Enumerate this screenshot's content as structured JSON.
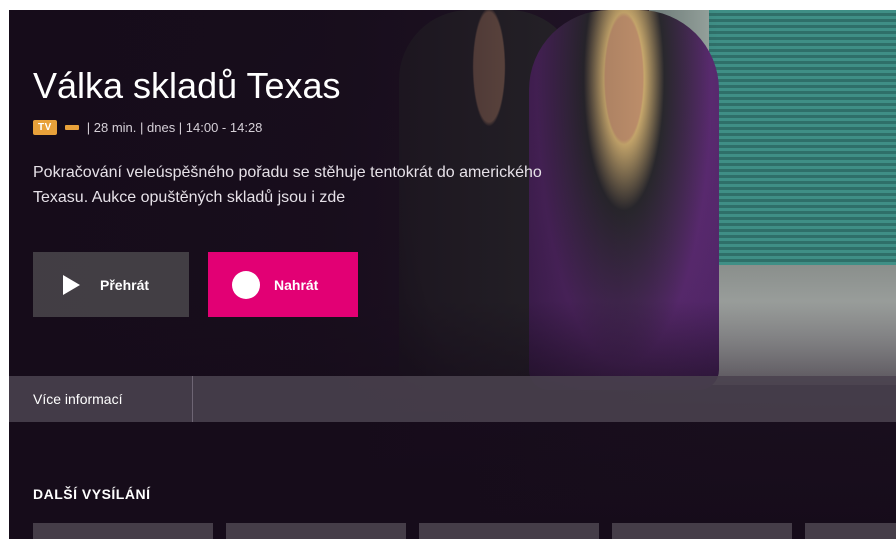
{
  "program": {
    "title": "Válka skladů Texas",
    "channel_badge": "TV",
    "meta_text": "| 28 min.  |  dnes  |  14:00 - 14:28",
    "description": "Pokračování veleúspěšného pořadu se stěhuje tentokrát do amerického Texasu. Aukce opuštěných skladů jsou i zde"
  },
  "actions": {
    "play_label": "Přehrát",
    "record_label": "Nahrát"
  },
  "tabs": {
    "more_info_label": "Více informací"
  },
  "next_airings": {
    "heading": "DALŠÍ VYSÍLÁNÍ",
    "tile_count_visible": 5
  },
  "colors": {
    "accent": "#e20074",
    "badge": "#e8a13a"
  }
}
